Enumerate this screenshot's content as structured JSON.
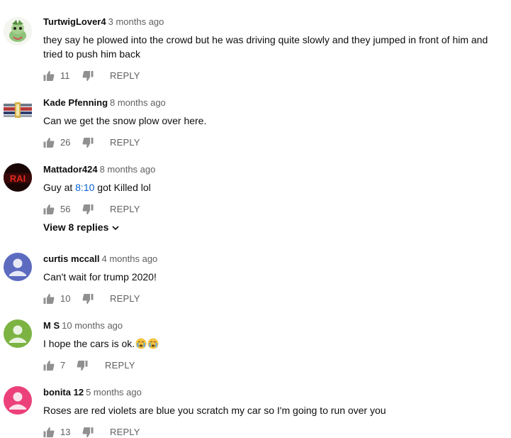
{
  "comments": [
    {
      "author": "TurtwigLover4",
      "time": "3 months ago",
      "text": "they say he plowed into the crowd but he was driving quite slowly and they jumped in front of him and tried to push him back",
      "likes": "11",
      "reply_label": "REPLY",
      "avatar": "turtwig-avatar"
    },
    {
      "author": "Kade Pfenning",
      "time": "8 months ago",
      "text": "Can we get the snow plow over here.",
      "likes": "26",
      "reply_label": "REPLY",
      "avatar": "emblem-avatar"
    },
    {
      "author": "Mattador424",
      "time": "8 months ago",
      "text_before": "Guy at ",
      "timestamp_link": "8:10",
      "text_after": " got Killed lol",
      "likes": "56",
      "reply_label": "REPLY",
      "view_replies": "View 8 replies",
      "avatar": "rai-logo-avatar",
      "avatar_text": "RAI"
    },
    {
      "author": "curtis mccall",
      "time": "4 months ago",
      "text": "Can't wait for trump 2020!",
      "likes": "10",
      "reply_label": "REPLY",
      "avatar": "default-user-avatar",
      "avatar_color": "#5c6bc0"
    },
    {
      "author": "M S",
      "time": "10 months ago",
      "text": "I hope the cars is ok.",
      "emojis": [
        "crying-face",
        "crying-face"
      ],
      "likes": "7",
      "reply_label": "REPLY",
      "avatar": "default-user-avatar",
      "avatar_color": "#7cb342"
    },
    {
      "author": "bonita 12",
      "time": "5 months ago",
      "text": "Roses are red violets are blue you scratch my car so I'm going to run over you",
      "likes": "13",
      "reply_label": "REPLY",
      "avatar": "default-user-avatar",
      "avatar_color": "#ec407a"
    }
  ],
  "colors": {
    "text": "#0d0d0d",
    "secondary": "#606060",
    "link": "#065fd4"
  }
}
